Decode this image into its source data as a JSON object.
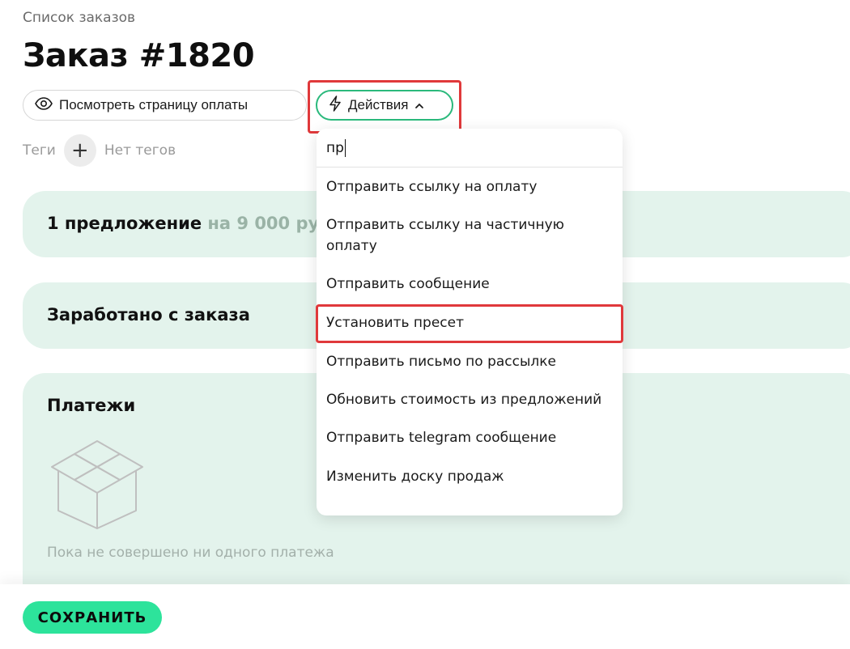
{
  "header": {
    "breadcrumb": "Список заказов",
    "title": "Заказ #1820"
  },
  "toolbar": {
    "view_payment_page": "Посмотреть страницу оплаты",
    "actions": "Действия"
  },
  "tags": {
    "label": "Теги",
    "empty": "Нет тегов"
  },
  "cards": {
    "offers_title": "1 предложение",
    "offers_amount": "на 9 000 ру",
    "earned_title": "Заработано с заказа",
    "payments_title": "Платежи",
    "payments_empty": "Пока не совершено ни одного платежа"
  },
  "footer": {
    "save": "СОХРАНИТЬ"
  },
  "actions_menu": {
    "search_value": "пр",
    "items": [
      "Отправить ссылку на оплату",
      "Отправить ссылку на частичную оплату",
      "Отправить сообщение",
      "Установить пресет",
      "Отправить письмо по рассылке",
      "Обновить стоимость из предложений",
      "Отправить telegram сообщение",
      "Изменить доску продаж"
    ],
    "highlighted_item": "Установить пресет"
  },
  "colors": {
    "accent": "#2de39b",
    "card_bg": "#e3f3ec",
    "highlight": "#e0393b"
  }
}
